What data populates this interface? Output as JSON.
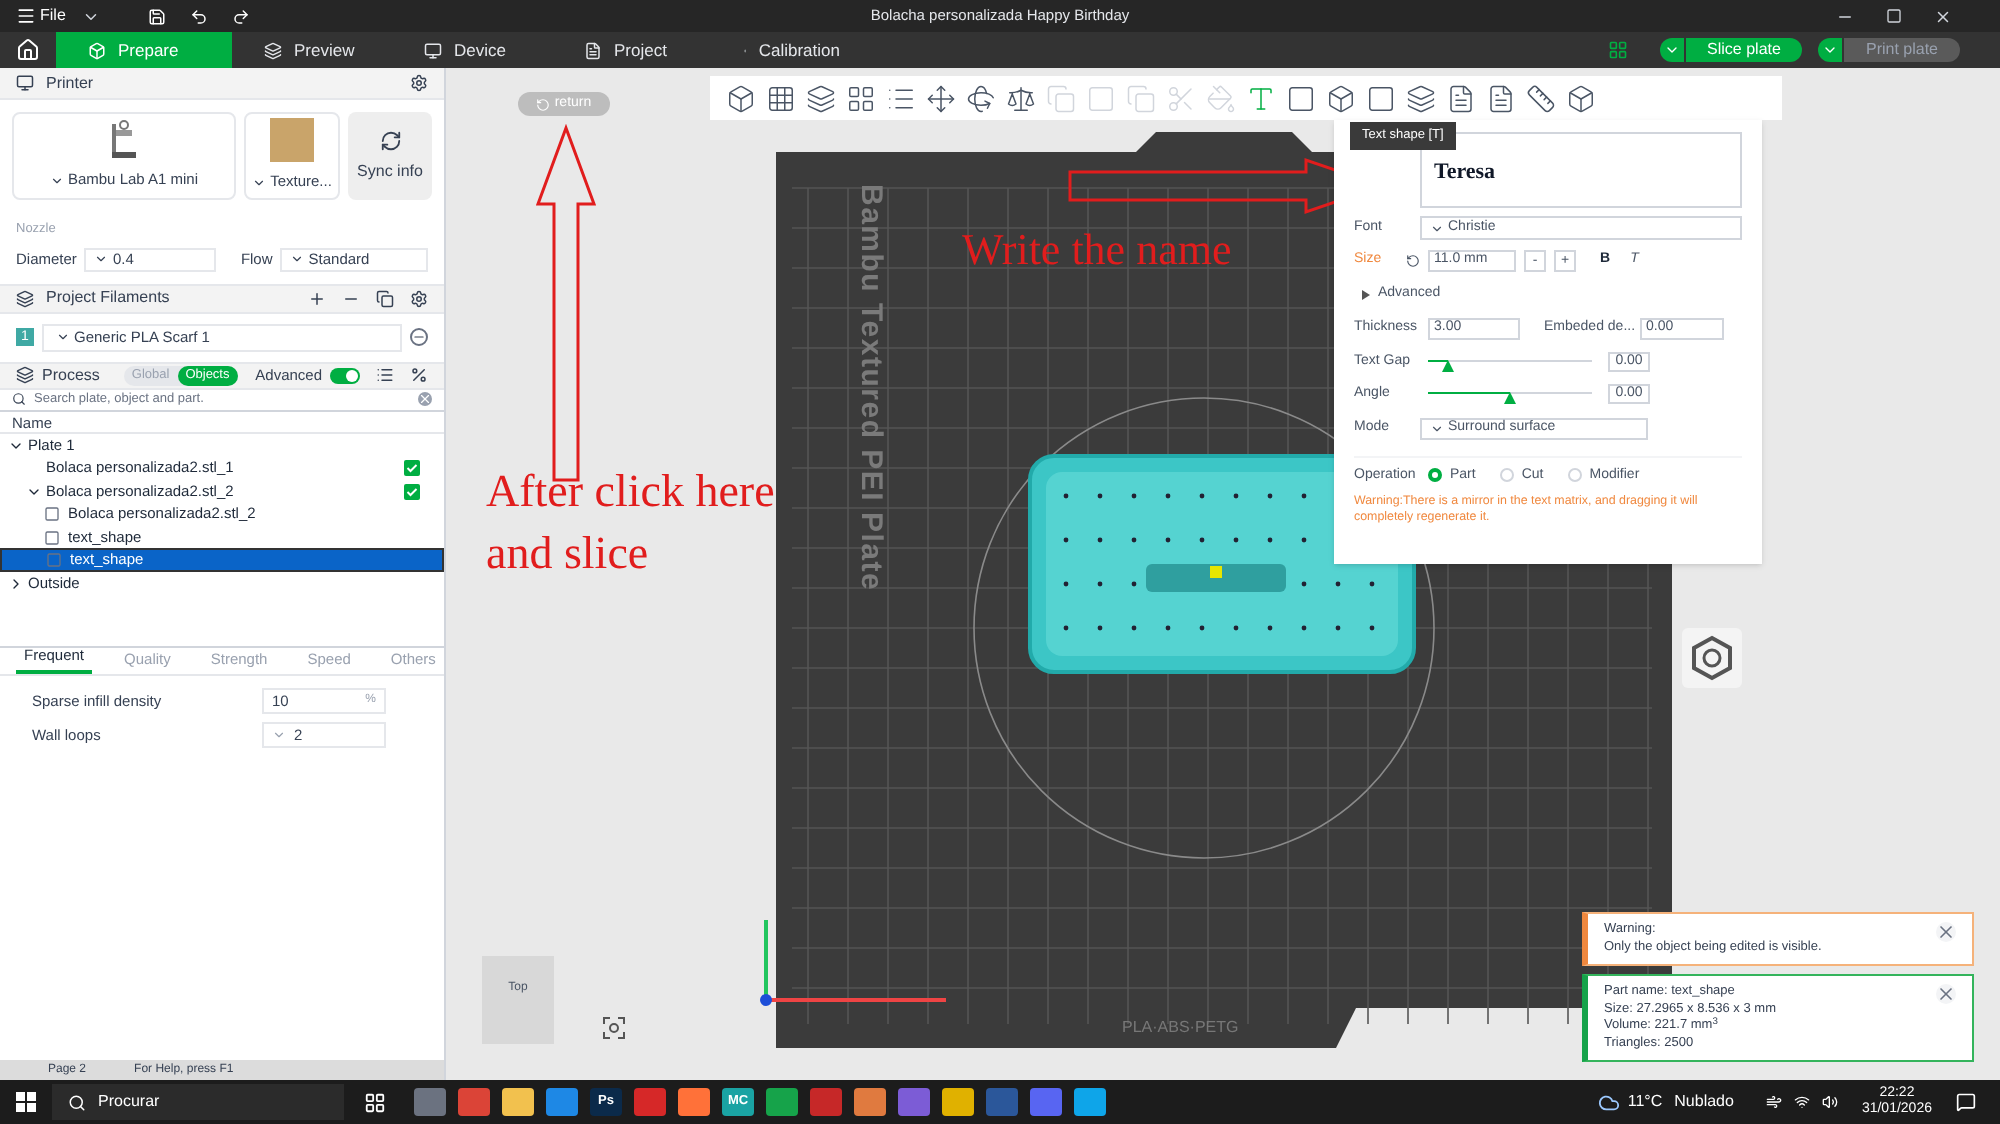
{
  "title_bar": {
    "menu": "File",
    "title": "Bolacha personalizada Happy Birthday"
  },
  "tabs": [
    {
      "label": "Prepare",
      "selected": true
    },
    {
      "label": "Preview",
      "selected": false
    },
    {
      "label": "Device",
      "selected": false
    },
    {
      "label": "Project",
      "selected": false
    },
    {
      "label": "Calibration",
      "selected": false
    }
  ],
  "slice_button": {
    "label": "Slice plate",
    "disabled": false
  },
  "print_button": {
    "label": "Print plate",
    "disabled": true
  },
  "printer": {
    "header": "Printer",
    "model": "Bambu Lab A1 mini",
    "plate": "Texture...",
    "sync": "Sync info",
    "nozzle_label": "Nozzle",
    "diameter_label": "Diameter",
    "diameter": "0.4",
    "flow_label": "Flow",
    "flow": "Standard"
  },
  "filaments": {
    "header": "Project Filaments",
    "items": [
      {
        "index": "1",
        "name": "Generic PLA Scarf 1",
        "color": "#3fa9a4"
      }
    ]
  },
  "process": {
    "header": "Process",
    "modes": [
      {
        "label": "Global",
        "selected": false
      },
      {
        "label": "Objects",
        "selected": true
      }
    ],
    "advanced_label": "Advanced",
    "advanced_on": true,
    "search_placeholder": "Search plate, object and part.",
    "column": "Name"
  },
  "tree": [
    {
      "label": "Plate 1",
      "expanded": true,
      "children": [
        {
          "label": "Bolaca personalizada2.stl_1",
          "checked": true
        },
        {
          "label": "Bolaca personalizada2.stl_2",
          "checked": true,
          "expanded": true,
          "children": [
            {
              "label": "Bolaca personalizada2.stl_2",
              "selected": false
            },
            {
              "label": "text_shape",
              "selected": false
            },
            {
              "label": "text_shape",
              "selected": true
            }
          ]
        }
      ]
    },
    {
      "label": "Outside",
      "expanded": false
    }
  ],
  "settings_tabs": [
    {
      "label": "Frequent",
      "selected": true
    },
    {
      "label": "Quality",
      "selected": false
    },
    {
      "label": "Strength",
      "selected": false
    },
    {
      "label": "Speed",
      "selected": false
    },
    {
      "label": "Others",
      "selected": false
    }
  ],
  "settings": [
    {
      "kind": "percent",
      "label": "Sparse infill density",
      "value": "10",
      "unit": "%"
    },
    {
      "kind": "spin",
      "label": "Wall loops",
      "value": "2"
    }
  ],
  "return_button": "return",
  "plate_label": "Bambu Textured PEI Plate",
  "plate_bottom_label": "PLA·ABS·PETG",
  "annotations": [
    {
      "kind": "arrow-right",
      "text": "Write the name"
    },
    {
      "kind": "arrow-up",
      "text": "After click here and slice"
    }
  ],
  "text_panel": {
    "tooltip": "Text shape [T]",
    "text": "Teresa",
    "font_label": "Font",
    "font": "Christie",
    "size_label": "Size",
    "size": "11.0 mm",
    "minus": "-",
    "plus": "+",
    "bold": "B",
    "italic": "T",
    "advanced": "Advanced",
    "thickness_label": "Thickness",
    "thickness": "3.00",
    "embed_label": "Embeded de...",
    "embed": "0.00",
    "sliders": [
      {
        "label": "Text Gap",
        "level": 0.12,
        "value": "0.00"
      },
      {
        "label": "Angle",
        "level": 0.5,
        "value": "0.00"
      }
    ],
    "mode_label": "Mode",
    "mode": "Surround surface",
    "operation_label": "Operation",
    "operations": [
      {
        "label": "Part",
        "selected": true
      },
      {
        "label": "Cut",
        "selected": false
      },
      {
        "label": "Modifier",
        "selected": false
      }
    ],
    "warning": "Warning:There is a mirror in the text matrix, and dragging it will completely regenerate it."
  },
  "view_cube": "Top",
  "notifications": [
    {
      "kind": "warning",
      "lines": [
        "Warning:",
        "Only the object being edited is visible."
      ]
    },
    {
      "kind": "info",
      "lines": [
        "Part name: text_shape",
        "Size: 27.2965 x 8.536 x 3 mm",
        "Volume: 221.7 mm$^{3}$",
        "Triangles: 2500"
      ]
    }
  ],
  "status_bar": {
    "page": "Page 2",
    "help": "For Help, press F1"
  },
  "taskbar": {
    "search": "Procurar",
    "apps": [
      {
        "color": "#6b7280"
      },
      {
        "color": "#db4437"
      },
      {
        "color": "#f2c14e"
      },
      {
        "color": "#1e88e5"
      },
      {
        "color": "#0b2a4a",
        "label": "Ps"
      },
      {
        "color": "#d62828"
      },
      {
        "color": "#ff7139"
      },
      {
        "color": "#1aa3a3",
        "label": "MC"
      },
      {
        "color": "#16a34a"
      },
      {
        "color": "#c62828"
      },
      {
        "color": "#e07a3f"
      },
      {
        "color": "#7c5cd6"
      },
      {
        "color": "#e0b100"
      },
      {
        "color": "#2b579a"
      },
      {
        "color": "#5865f2"
      },
      {
        "color": "#0ea5e9"
      }
    ],
    "temperature": "11°C",
    "weather": "Nublado",
    "time": "22:22",
    "date": "31/01/2026"
  }
}
